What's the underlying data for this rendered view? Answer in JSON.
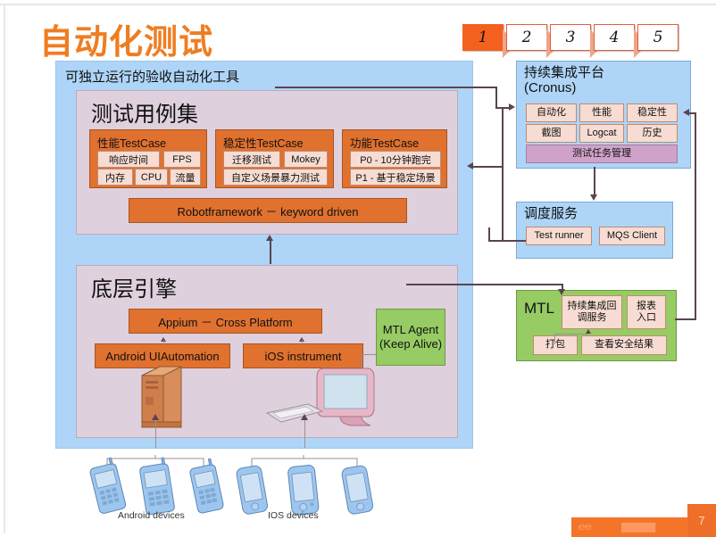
{
  "slide": {
    "title": "自动化测试",
    "page_number": "7",
    "footer_logo": "alibaba-logo",
    "accent_color": "#ef7d22"
  },
  "steps": {
    "items": [
      {
        "label": "1",
        "active": true
      },
      {
        "label": "2",
        "active": false
      },
      {
        "label": "3",
        "active": false
      },
      {
        "label": "4",
        "active": false
      },
      {
        "label": "5",
        "active": false
      }
    ]
  },
  "main_panel": {
    "title": "可独立运行的验收自动化工具",
    "testcase_section": {
      "heading": "测试用例集",
      "groups": [
        {
          "title": "性能TestCase",
          "chips": [
            "响应时间",
            "FPS",
            "内存",
            "CPU",
            "流量"
          ]
        },
        {
          "title": "稳定性TestCase",
          "chips": [
            "迁移测试",
            "Mokey",
            "自定义场景暴力测试"
          ]
        },
        {
          "title": "功能TestCase",
          "chips": [
            "P0 - 10分钟跑完",
            "P1 - 基于稳定场景"
          ]
        }
      ],
      "framework_bar": "Robotframework － keyword driven"
    },
    "engine_section": {
      "heading": "底层引擎",
      "cross_platform": "Appium － Cross Platform",
      "android_driver": "Android UIAutomation",
      "ios_driver": "iOS instrument",
      "agent": {
        "line1": "MTL Agent",
        "line2": "(Keep Alive)"
      }
    }
  },
  "right_column": {
    "ci_platform": {
      "title_line1": "持续集成平台",
      "title_line2": "(Cronus)",
      "chips": [
        "自动化",
        "性能",
        "稳定性",
        "截图",
        "Logcat",
        "历史"
      ],
      "task_manager": "测试任务管理"
    },
    "scheduler": {
      "title": "调度服务",
      "chips": [
        "Test runner",
        "MQS Client"
      ]
    },
    "mtl": {
      "title": "MTL",
      "callback": {
        "line1": "持续集成回",
        "line2": "调服务"
      },
      "report": {
        "line1": "报表",
        "line2": "入口"
      },
      "package": "打包",
      "security": "查看安全结果"
    }
  },
  "devices": {
    "android_label": "Android devices",
    "ios_label": "IOS devices",
    "server_icon": "server-icon",
    "pc_icon": "desktop-computer-icon",
    "android_phone_icon": "android-phone-icon",
    "ios_phone_icon": "ios-phone-icon"
  }
}
